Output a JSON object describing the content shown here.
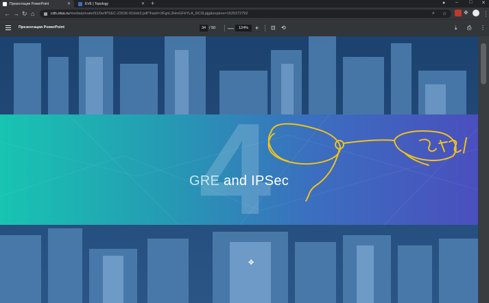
{
  "browser": {
    "tabs": [
      {
        "title": "Презентация PowerPoint",
        "active": true
      },
      {
        "title": "EVE | Topology",
        "active": false
      }
    ],
    "url_host": "cdn.otus.ru",
    "url_rest": "/media/private/91/0e/IPSEC-22636-910eb3.pdf?hash=3FgnL3HmGFkYLA_RC0Lpjg&expires=1625272792"
  },
  "pdf": {
    "title": "Презентация PowerPoint",
    "page": "34",
    "total": "/ 50",
    "zoom": "124%",
    "zoom_out": "—",
    "zoom_in": "+"
  },
  "slide": {
    "number": "4",
    "title_part1": "GRE",
    "title_part2": " and IPSec"
  },
  "colors": {
    "band_start": "#18c4b2",
    "band_end": "#4a4fbe",
    "annotation": "#f2c21b"
  },
  "icons": [
    "back-icon",
    "forward-icon",
    "reload-icon",
    "home-icon",
    "lock-icon",
    "search-icon",
    "star-icon",
    "menu-icon",
    "download-icon",
    "print-icon",
    "more-icon",
    "fit-page-icon",
    "rotate-icon"
  ]
}
